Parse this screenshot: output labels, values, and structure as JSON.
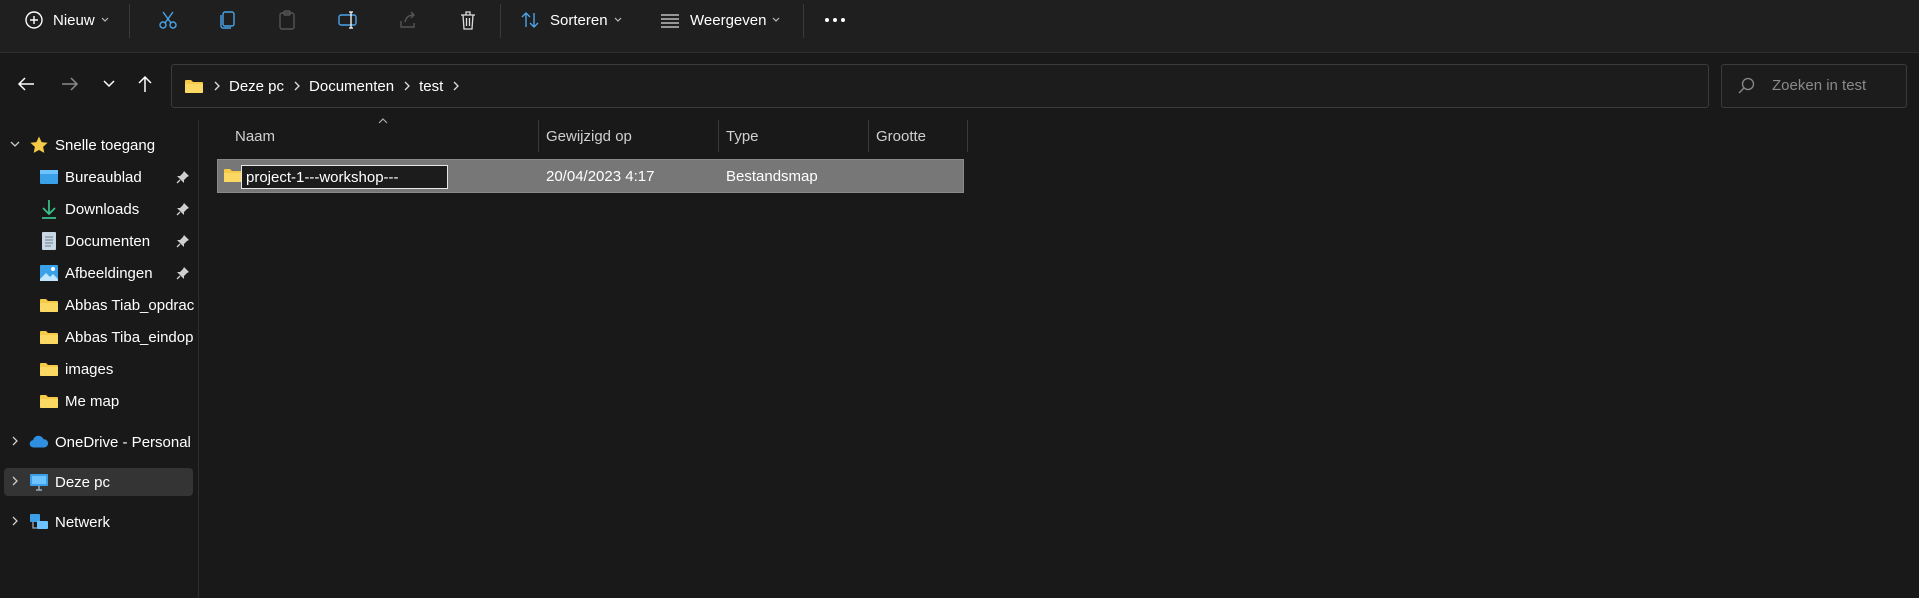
{
  "toolbar": {
    "new_label": "Nieuw",
    "sort_label": "Sorteren",
    "view_label": "Weergeven"
  },
  "breadcrumb": [
    "Deze pc",
    "Documenten",
    "test"
  ],
  "search": {
    "placeholder": "Zoeken in test"
  },
  "sidebar": {
    "quick_access": "Snelle toegang",
    "items": [
      {
        "label": "Bureaublad",
        "icon": "desktop-icon",
        "pinned": true
      },
      {
        "label": "Downloads",
        "icon": "download-icon",
        "pinned": true
      },
      {
        "label": "Documenten",
        "icon": "document-icon",
        "pinned": true
      },
      {
        "label": "Afbeeldingen",
        "icon": "pictures-icon",
        "pinned": true
      },
      {
        "label": "Abbas Tiab_opdrac",
        "icon": "folder-icon",
        "pinned": false
      },
      {
        "label": "Abbas Tiba_eindop",
        "icon": "folder-icon",
        "pinned": false
      },
      {
        "label": "images",
        "icon": "folder-icon",
        "pinned": false
      },
      {
        "label": "Me map",
        "icon": "folder-icon",
        "pinned": false
      }
    ],
    "onedrive": "OneDrive - Personal",
    "this_pc": "Deze pc",
    "network": "Netwerk"
  },
  "columns": {
    "name": "Naam",
    "modified": "Gewijzigd op",
    "type": "Type",
    "size": "Grootte"
  },
  "files": [
    {
      "name": "project-1---workshop---",
      "modified": "20/04/2023 4:17",
      "type": "Bestandsmap",
      "size": ""
    }
  ],
  "colors": {
    "background": "#191919",
    "selected_row": "#777777",
    "folder_yellow": "#f7c948",
    "accent_blue": "#4aa3e8"
  }
}
